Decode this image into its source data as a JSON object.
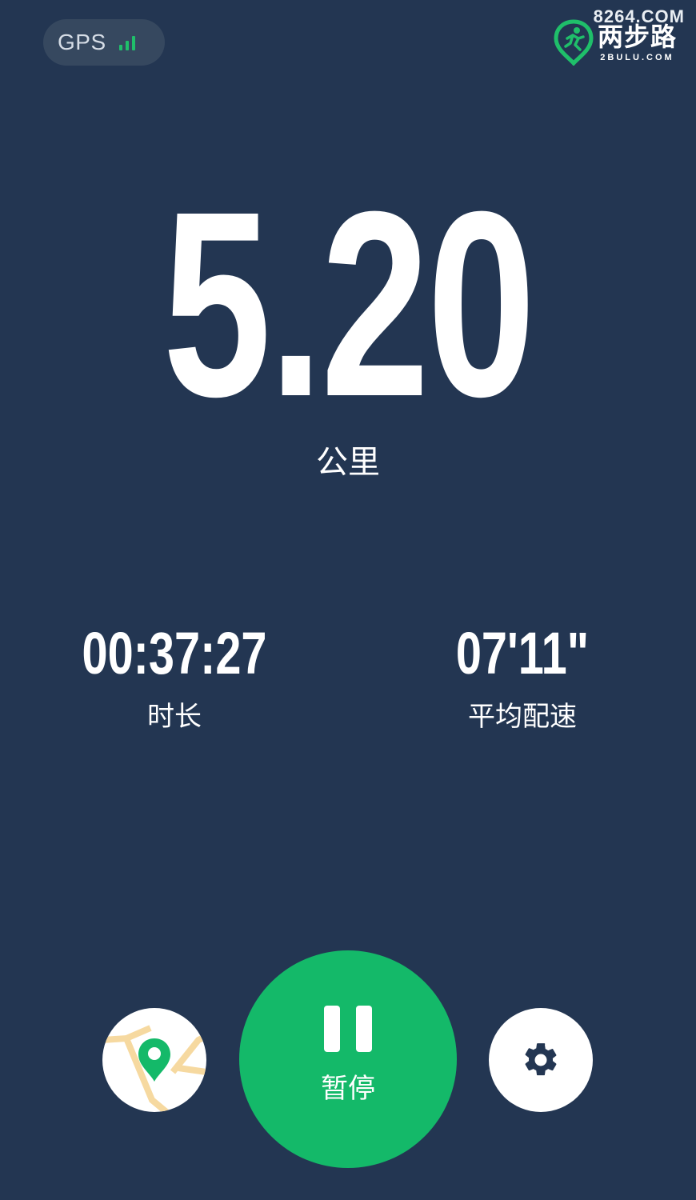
{
  "watermark": "8264.COM",
  "gps": {
    "label": "GPS",
    "signal_bars": 3
  },
  "brand": {
    "name": "两步路",
    "domain": "2BULU.COM"
  },
  "distance": {
    "value": "5.20",
    "unit": "公里"
  },
  "stats": {
    "duration": {
      "value": "00:37:27",
      "label": "时长"
    },
    "pace": {
      "value": "07'11\"",
      "label": "平均配速"
    }
  },
  "controls": {
    "map_icon": "map-pin-icon",
    "pause_label": "暂停",
    "pause_icon": "pause-icon",
    "settings_icon": "gear-icon"
  },
  "colors": {
    "background": "#233652",
    "accent": "#14b969",
    "gps_pill": "#36485f",
    "map_road": "#f6d9a0"
  }
}
